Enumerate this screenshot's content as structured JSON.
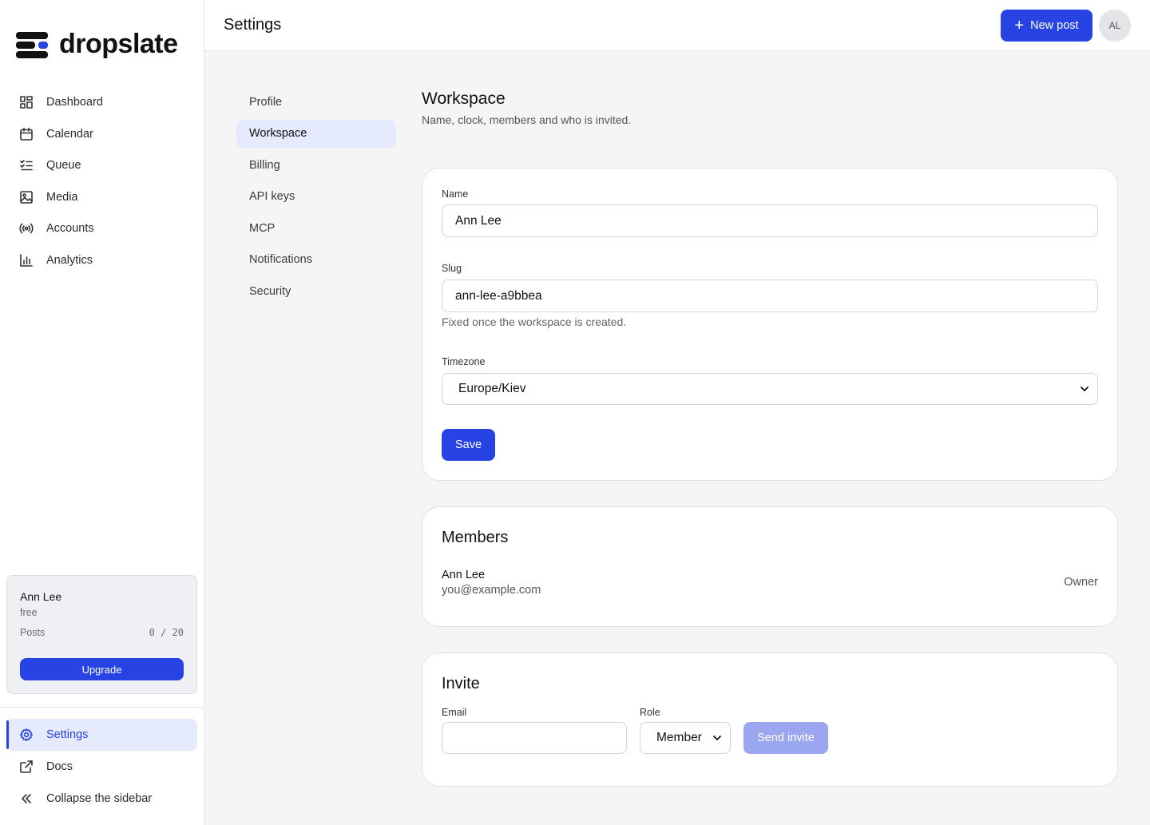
{
  "brand": {
    "name": "dropslate",
    "accent": "#2743e3"
  },
  "sidebar": {
    "items": [
      {
        "label": "Dashboard",
        "icon": "dashboard-icon"
      },
      {
        "label": "Calendar",
        "icon": "calendar-icon"
      },
      {
        "label": "Queue",
        "icon": "queue-icon"
      },
      {
        "label": "Media",
        "icon": "image-icon"
      },
      {
        "label": "Accounts",
        "icon": "broadcast-icon"
      },
      {
        "label": "Analytics",
        "icon": "bar-chart-icon"
      }
    ],
    "plan": {
      "user": "Ann Lee",
      "tier": "free",
      "posts_label": "Posts",
      "posts_count": "0 / 20",
      "upgrade_label": "Upgrade"
    },
    "bottom": [
      {
        "label": "Settings",
        "icon": "gear-icon",
        "active": true
      },
      {
        "label": "Docs",
        "icon": "external-link-icon"
      },
      {
        "label": "Collapse the sidebar",
        "icon": "chevrons-left-icon"
      }
    ]
  },
  "header": {
    "title": "Settings",
    "new_post_label": "New post",
    "avatar_initials": "AL"
  },
  "settings_nav": {
    "items": [
      "Profile",
      "Workspace",
      "Billing",
      "API keys",
      "MCP",
      "Notifications",
      "Security"
    ],
    "active": "Workspace"
  },
  "workspace": {
    "title": "Workspace",
    "subtitle": "Name, clock, members and who is invited.",
    "name_label": "Name",
    "name_value": "Ann Lee",
    "slug_label": "Slug",
    "slug_value": "ann-lee-a9bbea",
    "slug_help": "Fixed once the workspace is created.",
    "timezone_label": "Timezone",
    "timezone_value": "Europe/Kiev",
    "save_label": "Save"
  },
  "members": {
    "title": "Members",
    "list": [
      {
        "name": "Ann Lee",
        "email": "you@example.com",
        "role": "Owner"
      }
    ]
  },
  "invite": {
    "title": "Invite",
    "email_label": "Email",
    "email_value": "",
    "role_label": "Role",
    "role_value": "Member",
    "send_label": "Send invite"
  }
}
